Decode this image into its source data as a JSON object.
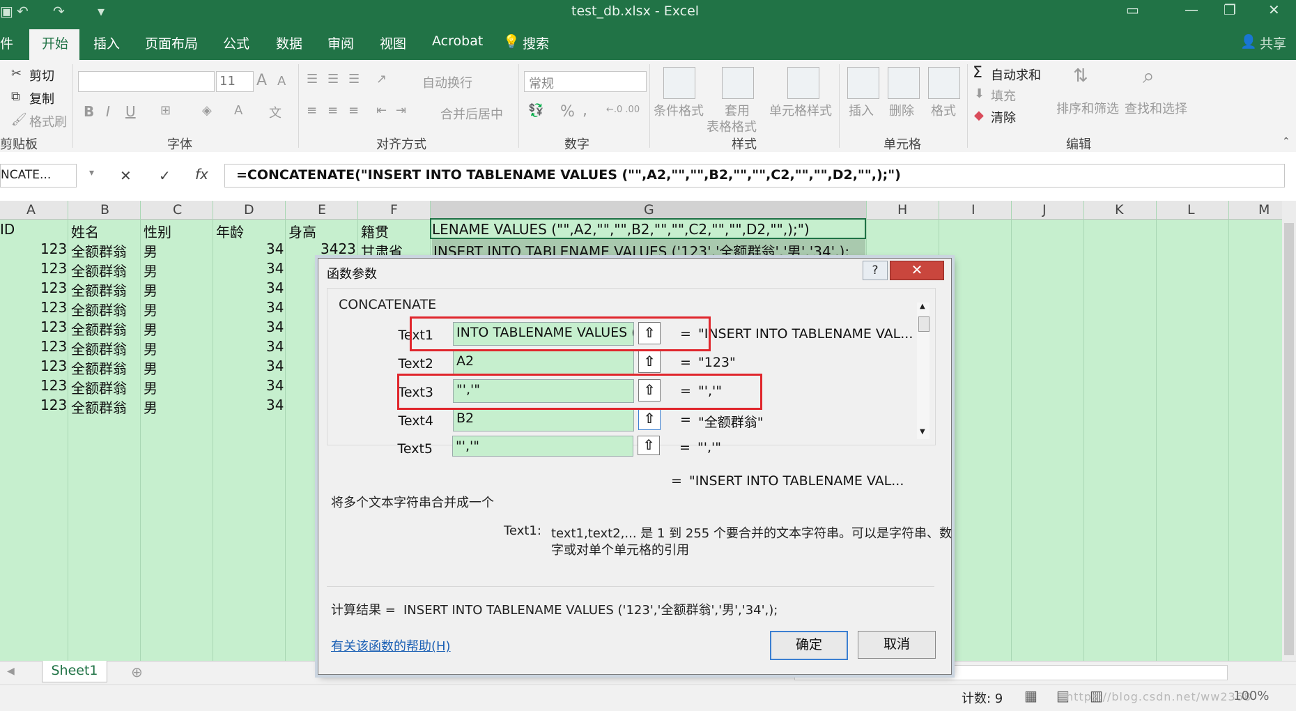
{
  "window": {
    "title": "test_db.xlsx  -  Excel",
    "minimize": "—",
    "restore": "❐",
    "close": "✕"
  },
  "tabs": [
    {
      "label": "件"
    },
    {
      "label": "开始"
    },
    {
      "label": "插入"
    },
    {
      "label": "页面布局"
    },
    {
      "label": "公式"
    },
    {
      "label": "数据"
    },
    {
      "label": "审阅"
    },
    {
      "label": "视图"
    },
    {
      "label": "Acrobat"
    },
    {
      "label": "搜索"
    }
  ],
  "share_label": "共享",
  "ribbon": {
    "clipboard": {
      "cut": "剪切",
      "copy": "复制",
      "format_painter": "格式刷",
      "group": "剪贴板"
    },
    "font": {
      "size": "11",
      "group": "字体",
      "bold": "B",
      "italic": "I",
      "underline": "U"
    },
    "alignment": {
      "wrap": "自动换行",
      "merge": "合并后居中",
      "group": "对齐方式"
    },
    "number": {
      "format": "常规",
      "percent": "%",
      "comma": ",",
      "group": "数字"
    },
    "styles": {
      "conditional": "条件格式",
      "table_line1": "套用",
      "table_line2": "表格格式",
      "cell_styles": "单元格样式",
      "group": "样式"
    },
    "cells": {
      "insert": "插入",
      "delete": "删除",
      "format": "格式",
      "group": "单元格"
    },
    "editing": {
      "autosum": "自动求和",
      "fill": "填充",
      "clear": "清除",
      "sort": "排序和筛选",
      "find": "查找和选择",
      "group": "编辑"
    }
  },
  "formula_bar": {
    "name_box": "NCATE...",
    "cancel": "✕",
    "enter": "✓",
    "fx": "fx",
    "formula": "=CONCATENATE(\"INSERT INTO TABLENAME VALUES (\"\",A2,\"\",\"\",B2,\"\",\"\",C2,\"\",\"\",D2,\"\",);\")"
  },
  "columns": [
    "A",
    "B",
    "C",
    "D",
    "E",
    "F",
    "G",
    "H",
    "I",
    "J",
    "K",
    "L",
    "M"
  ],
  "header_row": {
    "a": "ID",
    "b": "姓名",
    "c": "性别",
    "d": "年龄",
    "e": "身高",
    "f": "籍贯",
    "g": "LENAME VALUES (\"\",A2,\"\",\"\",B2,\"\",\"\",C2,\"\",\"\",D2,\"\",);\")"
  },
  "row2": {
    "a": "123",
    "b": "全额群翁",
    "c": "男",
    "d": "34",
    "e": "3423",
    "f": "甘肃省",
    "g": "INSERT INTO TABLENAME VALUES ('123','全额群翁','男','34',);"
  },
  "data_rows": [
    {
      "a": "123",
      "b": "全额群翁",
      "c": "男",
      "d": "34"
    },
    {
      "a": "123",
      "b": "全额群翁",
      "c": "男",
      "d": "34"
    },
    {
      "a": "123",
      "b": "全额群翁",
      "c": "男",
      "d": "34"
    },
    {
      "a": "123",
      "b": "全额群翁",
      "c": "男",
      "d": "34"
    },
    {
      "a": "123",
      "b": "全额群翁",
      "c": "男",
      "d": "34"
    },
    {
      "a": "123",
      "b": "全额群翁",
      "c": "男",
      "d": "34"
    },
    {
      "a": "123",
      "b": "全额群翁",
      "c": "男",
      "d": "34"
    },
    {
      "a": "123",
      "b": "全额群翁",
      "c": "男",
      "d": "34"
    }
  ],
  "dialog": {
    "title": "函数参数",
    "help_glyph": "?",
    "close_glyph": "✕",
    "function_name": "CONCATENATE",
    "args": [
      {
        "label": "Text1",
        "value": "INTO TABLENAME VALUES ('\"",
        "result": "\"INSERT INTO TABLENAME VAL..."
      },
      {
        "label": "Text2",
        "value": "A2",
        "result": "\"123\""
      },
      {
        "label": "Text3",
        "value": "\"','\"",
        "result": "\"','\""
      },
      {
        "label": "Text4",
        "value": "B2",
        "result": "\"全额群翁\""
      },
      {
        "label": "Text5",
        "value": "\"','\"",
        "result": "\"','\""
      }
    ],
    "equals": "=",
    "total_result": "\"INSERT INTO TABLENAME VAL...",
    "description": "将多个文本字符串合并成一个",
    "arg_help_label": "Text1:",
    "arg_help_text_1": "text1,text2,... 是 1 到 255 个要合并的文本字符串。可以是字符串、数",
    "arg_help_text_2": "字或对单个单元格的引用",
    "calc_label": "计算结果 =",
    "calc_value": "INSERT INTO TABLENAME VALUES ('123','全额群翁','男','34',);",
    "help_link": "有关该函数的帮助(H)",
    "ok": "确定",
    "cancel": "取消"
  },
  "sheet_tab": "Sheet1",
  "status": {
    "count": "计数: 9",
    "zoom": "100%",
    "watermark": "https://blog.csdn.net/ww2368"
  }
}
